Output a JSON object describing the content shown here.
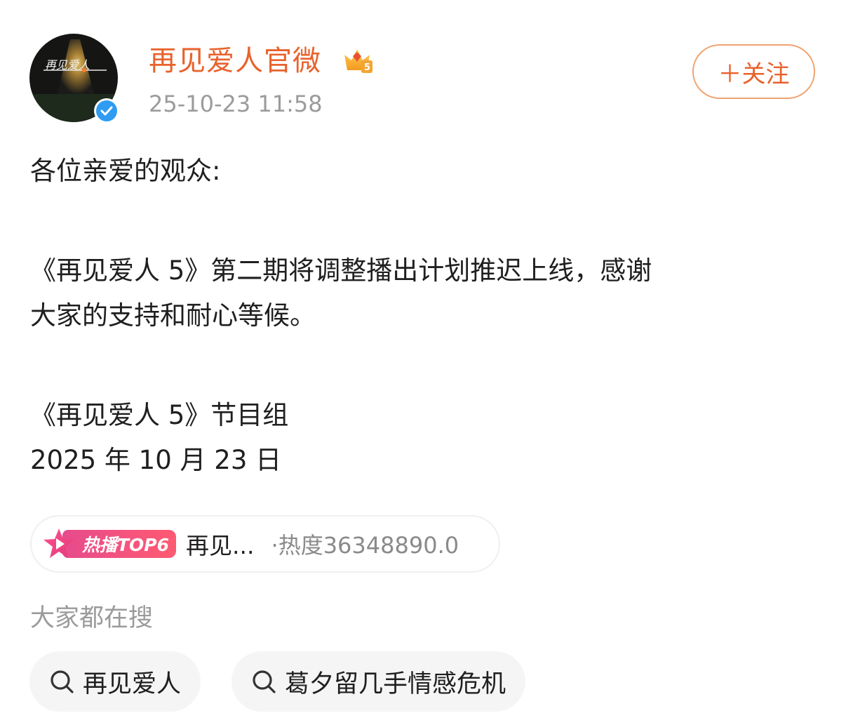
{
  "post": {
    "author": "再见爱人官微",
    "timestamp": "25-10-23 11:58",
    "follow_label": "＋关注",
    "avatar_text": "再见爱人",
    "paragraphs": {
      "greeting": "各位亲爱的观众:",
      "line1": "《再见爱人 5》第二期将调整播出计划推迟上线，感谢",
      "line2": "大家的支持和耐心等候。",
      "signature": "《再见爱人 5》节目组",
      "date": "2025 年 10 月 23 日"
    }
  },
  "hot_topic": {
    "badge": "热播TOP6",
    "title": "再见...",
    "heat": "·热度36348890.0"
  },
  "searches": {
    "heading": "大家都在搜",
    "items": [
      "再见爱人",
      "葛夕留几手情感危机"
    ]
  },
  "colors": {
    "accent": "#e8622c",
    "verified": "#2f9cf1",
    "muted": "#9b9b9b",
    "hot_badge": "#ff5a72"
  },
  "icons": {
    "verified": "verified-check-icon",
    "vip": "vip-crown-icon",
    "hot": "hot-star-icon",
    "search": "search-icon"
  }
}
